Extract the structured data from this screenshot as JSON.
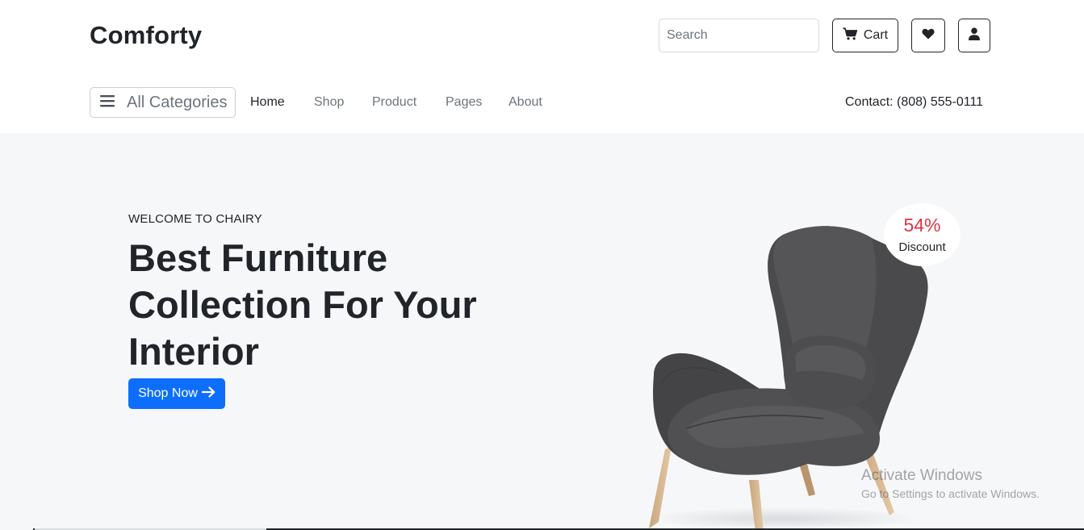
{
  "brand": "Comforty",
  "search": {
    "placeholder": "Search"
  },
  "header_actions": {
    "cart_label": "Cart",
    "cart_icon": "cart-icon",
    "wishlist_icon": "heart-icon",
    "account_icon": "user-icon"
  },
  "nav": {
    "categories_label": "All Categories",
    "categories_icon": "hamburger-icon",
    "links": [
      {
        "label": "Home",
        "active": true
      },
      {
        "label": "Shop",
        "active": false
      },
      {
        "label": "Product",
        "active": false
      },
      {
        "label": "Pages",
        "active": false
      },
      {
        "label": "About",
        "active": false
      }
    ],
    "contact": "Contact: (808) 555-0111"
  },
  "hero": {
    "eyebrow": "WELCOME TO CHAIRY",
    "headline": "Best Furniture Collection For Your Interior",
    "cta_label": "Shop Now",
    "cta_icon": "arrow-right-icon",
    "discount_value": "54%",
    "discount_label": "Discount",
    "image": "armchair-image"
  },
  "watermark": {
    "title": "Activate Windows",
    "subtitle": "Go to Settings to activate Windows."
  },
  "colors": {
    "primary": "#0d6efd",
    "discount": "#dc3545",
    "hero_bg": "#f6f7f9",
    "text": "#212529",
    "muted": "#6c757d"
  }
}
